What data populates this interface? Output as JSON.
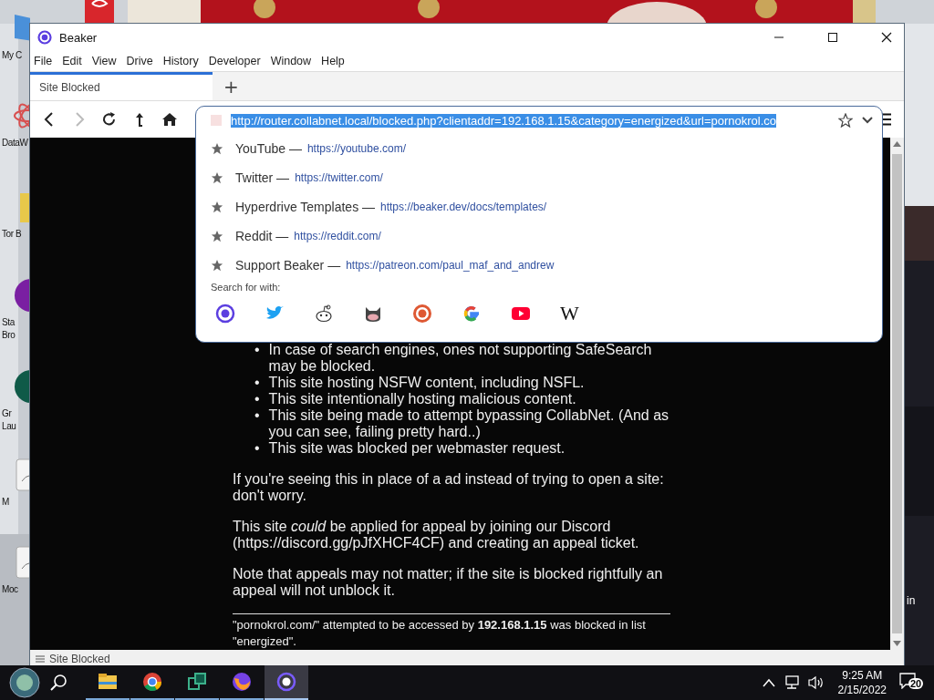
{
  "desktop": {
    "icons": [
      {
        "kind": "computer",
        "lines": [
          "My C"
        ]
      },
      {
        "kind": "atom",
        "lines": [
          "DataW"
        ]
      },
      {
        "kind": "folder",
        "lines": [
          "Tor B"
        ]
      },
      {
        "kind": "purple",
        "lines": [
          "Sta",
          "Bro"
        ]
      },
      {
        "kind": "green",
        "lines": [
          "Gr",
          "Lau"
        ]
      },
      {
        "kind": "tile",
        "lines": [
          "M"
        ]
      },
      {
        "kind": "doc",
        "lines": [
          "Moc"
        ]
      },
      {
        "kind": "bin",
        "lines": [
          "in"
        ]
      },
      {
        "kind": "red"
      }
    ]
  },
  "window": {
    "title": "Beaker",
    "menu": [
      "File",
      "Edit",
      "View",
      "Drive",
      "History",
      "Developer",
      "Window",
      "Help"
    ],
    "tabs": [
      {
        "label": "Site Blocked",
        "selected": true
      }
    ],
    "new_tab": "+",
    "nav": [
      {
        "kind": "back",
        "disabled": false
      },
      {
        "kind": "forward",
        "disabled": true
      },
      {
        "kind": "reload",
        "disabled": false
      },
      {
        "kind": "up",
        "disabled": false
      },
      {
        "kind": "home",
        "disabled": false
      }
    ],
    "address": {
      "value": "http://router.collabnet.local/blocked.php?clientaddr=192.168.1.15&category=energized&url=pornokrol.co",
      "selected": true
    },
    "suggestions": [
      {
        "title": "YouTube —",
        "url": "https://youtube.com/"
      },
      {
        "title": "Twitter —",
        "url": "https://twitter.com/"
      },
      {
        "title": "Hyperdrive Templates —",
        "url": "https://beaker.dev/docs/templates/"
      },
      {
        "title": "Reddit —",
        "url": "https://reddit.com/"
      },
      {
        "title": "Support Beaker —",
        "url": "https://patreon.com/paul_maf_and_andrew"
      }
    ],
    "search_label": "Search for with:",
    "search_engines": [
      {
        "kind": "beaker"
      },
      {
        "kind": "twitter"
      },
      {
        "kind": "reddit"
      },
      {
        "kind": "github"
      },
      {
        "kind": "duckduckgo"
      },
      {
        "kind": "google"
      },
      {
        "kind": "youtube"
      },
      {
        "kind": "wikipedia",
        "glyph": "W"
      }
    ],
    "page": {
      "list": [
        {
          "marker": "•",
          "text": "In case of search engines, ones not supporting SafeSearch may be blocked."
        },
        {
          "marker": "•",
          "text": "This site hosting NSFW content, including NSFL."
        },
        {
          "marker": "•",
          "text": "This site intentionally hosting malicious content."
        },
        {
          "marker": "•",
          "text": "This site being made to attempt bypassing CollabNet. (And as you can see, failing pretty hard..)"
        },
        {
          "marker": "•",
          "text": "This site was blocked per webmaster request."
        }
      ],
      "paragraphs": [
        "If you're seeing this in place of a ad instead of trying to open a site: don't worry.",
        "This site *could* be applied for appeal by joining our Discord (https://discord.gg/pJfXHCF4CF) and creating an appeal ticket.",
        "Note that appeals may not matter; if the site is blocked rightfully an appeal will not unblock it."
      ],
      "footer": "\"pornokrol.com/\" attempted to be accessed by **192.168.1.15** was blocked in list \"energized\"."
    },
    "status_bar": "Site Blocked"
  },
  "taskbar": {
    "apps": [
      {
        "kind": "explorer",
        "selected": false
      },
      {
        "kind": "chrome",
        "selected": false
      },
      {
        "kind": "cube",
        "selected": false
      },
      {
        "kind": "firefox",
        "selected": false
      },
      {
        "kind": "beaker",
        "selected": true
      }
    ],
    "time": "9:25 AM",
    "date": "2/15/2022",
    "notifications": "20"
  }
}
